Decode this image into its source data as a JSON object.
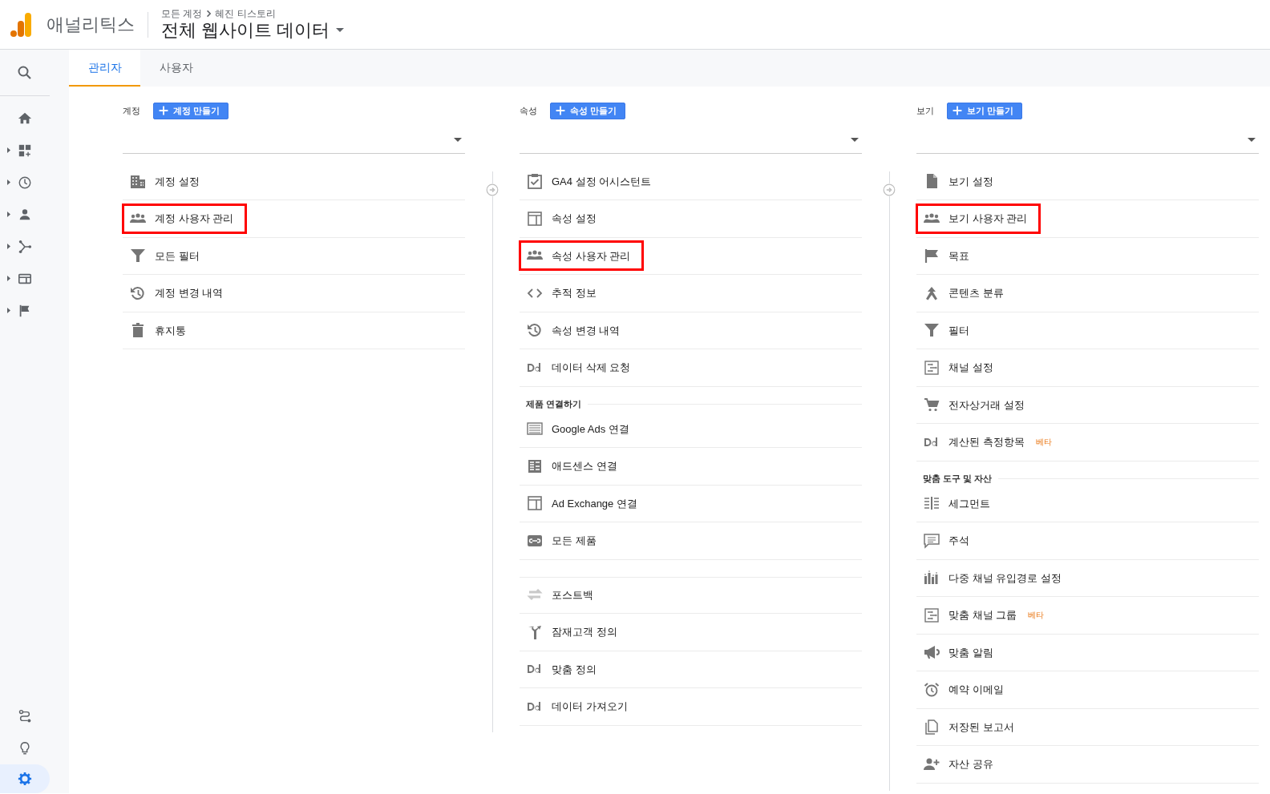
{
  "header": {
    "product_name": "애널리틱스",
    "breadcrumb": [
      "모든 계정",
      "혜진 티스토리"
    ],
    "title": "전체 웹사이트 데이터"
  },
  "sidebar": {
    "items": [
      {
        "expandable": false
      },
      {
        "expandable": true
      },
      {
        "expandable": true
      },
      {
        "expandable": true
      },
      {
        "expandable": true
      },
      {
        "expandable": true
      },
      {
        "expandable": true
      }
    ],
    "bottom_items": [
      {
        "selected": false
      },
      {
        "selected": false
      },
      {
        "selected": true
      }
    ]
  },
  "tabs": [
    {
      "label": "관리자",
      "selected": true
    },
    {
      "label": "사용자",
      "selected": false
    }
  ],
  "columns": [
    {
      "label": "계정",
      "create_button": "계정 만들기",
      "sections": [
        {
          "items": [
            {
              "label": "계정 설정",
              "highlighted": false
            },
            {
              "label": "계정 사용자 관리",
              "highlighted": true
            },
            {
              "label": "모든 필터",
              "highlighted": false
            },
            {
              "label": "계정 변경 내역",
              "highlighted": false
            },
            {
              "label": "휴지통",
              "highlighted": false
            }
          ]
        }
      ]
    },
    {
      "label": "속성",
      "create_button": "속성 만들기",
      "sections": [
        {
          "items": [
            {
              "label": "GA4 설정 어시스턴트",
              "highlighted": false
            },
            {
              "label": "속성 설정",
              "highlighted": false
            },
            {
              "label": "속성 사용자 관리",
              "highlighted": true
            },
            {
              "label": "추적 정보",
              "highlighted": false
            },
            {
              "label": "속성 변경 내역",
              "highlighted": false
            },
            {
              "label": "데이터 삭제 요청",
              "highlighted": false
            }
          ]
        },
        {
          "heading": "제품 연결하기",
          "items": [
            {
              "label": "Google Ads 연결",
              "highlighted": false
            },
            {
              "label": "애드센스 연결",
              "highlighted": false
            },
            {
              "label": "Ad Exchange 연결",
              "highlighted": false
            },
            {
              "label": "모든 제품",
              "highlighted": false
            }
          ]
        },
        {
          "items": [
            {
              "label": "포스트백",
              "highlighted": false
            },
            {
              "label": "잠재고객 정의",
              "highlighted": false
            },
            {
              "label": "맞춤 정의",
              "highlighted": false
            },
            {
              "label": "데이터 가져오기",
              "highlighted": false
            }
          ]
        }
      ]
    },
    {
      "label": "보기",
      "create_button": "보기 만들기",
      "sections": [
        {
          "items": [
            {
              "label": "보기 설정",
              "highlighted": false
            },
            {
              "label": "보기 사용자 관리",
              "highlighted": true
            },
            {
              "label": "목표",
              "highlighted": false
            },
            {
              "label": "콘텐츠 분류",
              "highlighted": false
            },
            {
              "label": "필터",
              "highlighted": false
            },
            {
              "label": "채널 설정",
              "highlighted": false
            },
            {
              "label": "전자상거래 설정",
              "highlighted": false
            },
            {
              "label": "계산된 측정항목",
              "badge": "베타",
              "highlighted": false
            }
          ]
        },
        {
          "heading": "맞춤 도구 및 자산",
          "items": [
            {
              "label": "세그먼트",
              "highlighted": false
            },
            {
              "label": "주석",
              "highlighted": false
            },
            {
              "label": "다중 채널 유입경로 설정",
              "highlighted": false
            },
            {
              "label": "맞춤 채널 그룹",
              "badge": "베타",
              "highlighted": false
            },
            {
              "label": "맞춤 알림",
              "highlighted": false
            },
            {
              "label": "예약 이메일",
              "highlighted": false
            },
            {
              "label": "저장된 보고서",
              "highlighted": false
            },
            {
              "label": "자산 공유",
              "highlighted": false
            }
          ]
        }
      ]
    }
  ]
}
